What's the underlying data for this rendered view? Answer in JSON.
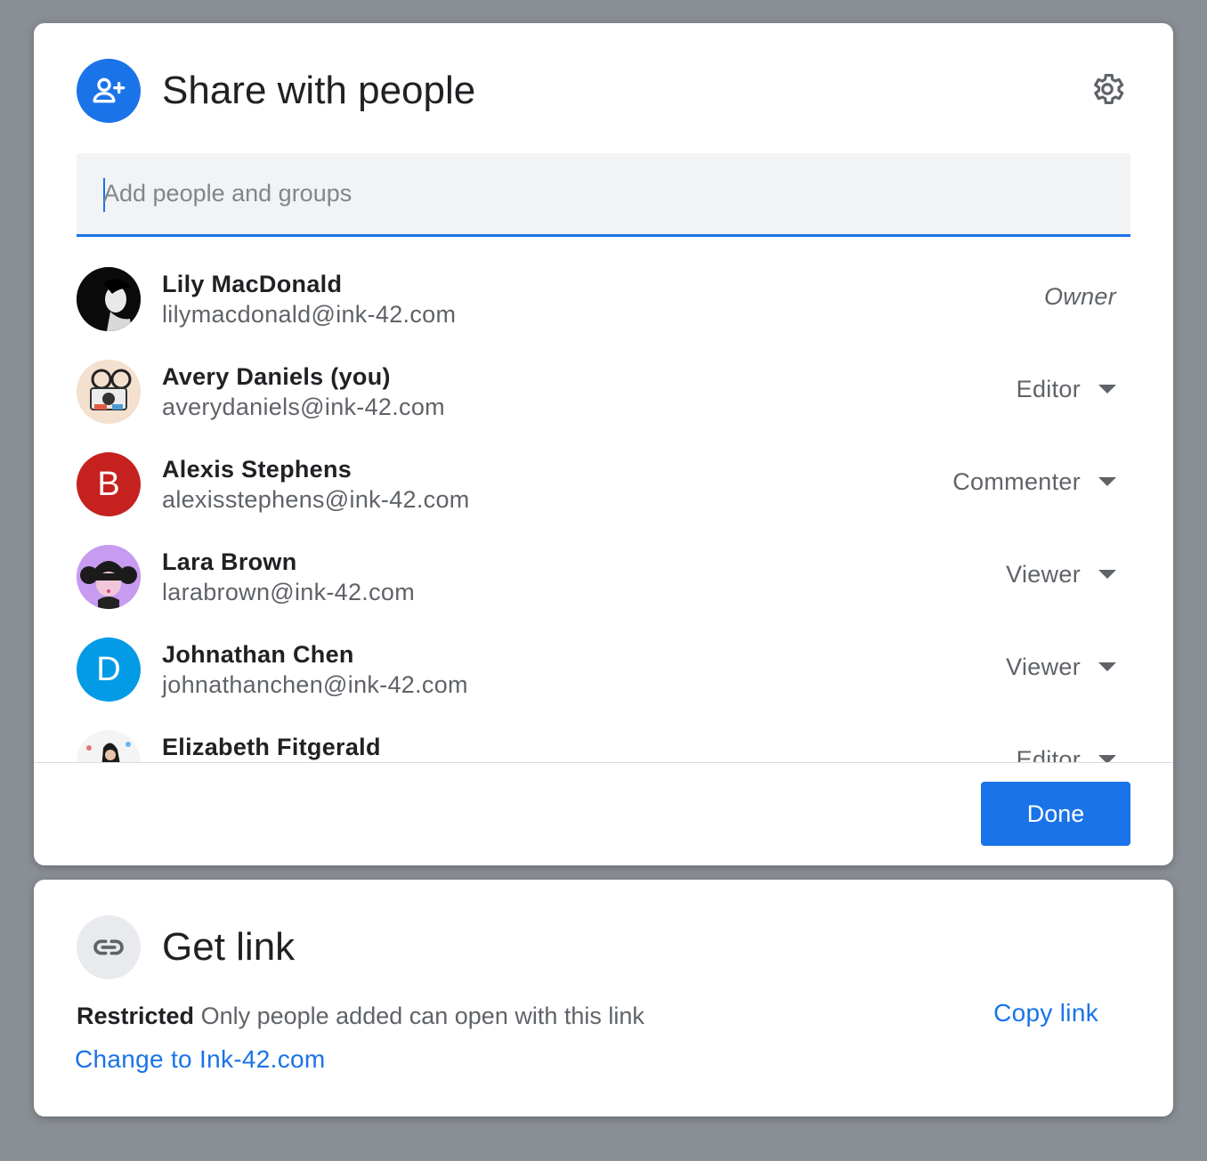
{
  "share": {
    "title": "Share with people",
    "search_placeholder": "Add people and groups",
    "done_label": "Done",
    "people": [
      {
        "name": "Lily MacDonald",
        "email": "lilymacdonald@ink-42.com",
        "role": "Owner",
        "avatar": "photo"
      },
      {
        "name": "Avery Daniels (you)",
        "email": "averydaniels@ink-42.com",
        "role": "Editor",
        "avatar": "photo"
      },
      {
        "name": "Alexis Stephens",
        "email": "alexisstephens@ink-42.com",
        "role": "Commenter",
        "avatar_letter": "B",
        "avatar_color": "#c5221f"
      },
      {
        "name": "Lara Brown",
        "email": "larabrown@ink-42.com",
        "role": "Viewer",
        "avatar": "illustration"
      },
      {
        "name": "Johnathan Chen",
        "email": "johnathanchen@ink-42.com",
        "role": "Viewer",
        "avatar_letter": "D",
        "avatar_color": "#039be5"
      },
      {
        "name": "Elizabeth Fitgerald",
        "email": "",
        "role": "Editor",
        "avatar": "photo"
      }
    ]
  },
  "link": {
    "title": "Get link",
    "restricted_label": "Restricted",
    "restricted_desc": "Only people added can open with this link",
    "change_label": "Change to Ink-42.com",
    "copy_label": "Copy link"
  },
  "colors": {
    "accent": "#1a73e8",
    "text_primary": "#202124",
    "text_secondary": "#5f6368"
  },
  "icons": {
    "header": "add-person-icon",
    "settings": "gear-icon",
    "link": "link-icon",
    "dropdown": "caret-down-icon"
  }
}
